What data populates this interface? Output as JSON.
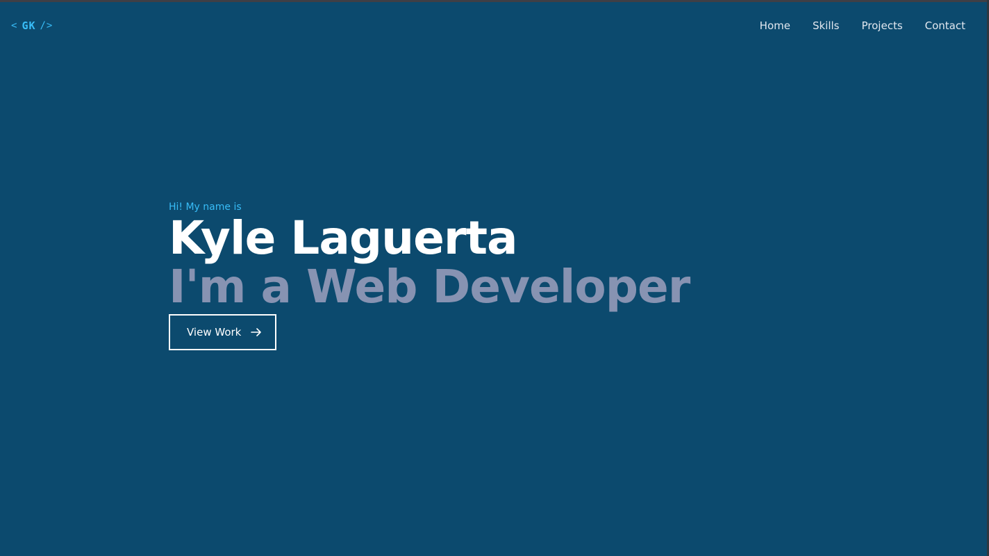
{
  "logo": {
    "open": "<",
    "initials": "GK",
    "close": "/>"
  },
  "nav": {
    "items": [
      "Home",
      "Skills",
      "Projects",
      "Contact"
    ]
  },
  "hero": {
    "intro": "Hi! My name is",
    "name": "Kyle Laguerta",
    "role": "I'm a Web Developer",
    "cta_label": "View Work",
    "cta_icon": "arrow-right-icon"
  },
  "colors": {
    "background": "#0c4a6e",
    "accent": "#38bdf8",
    "muted_heading": "#8793b2",
    "text": "#ffffff"
  }
}
